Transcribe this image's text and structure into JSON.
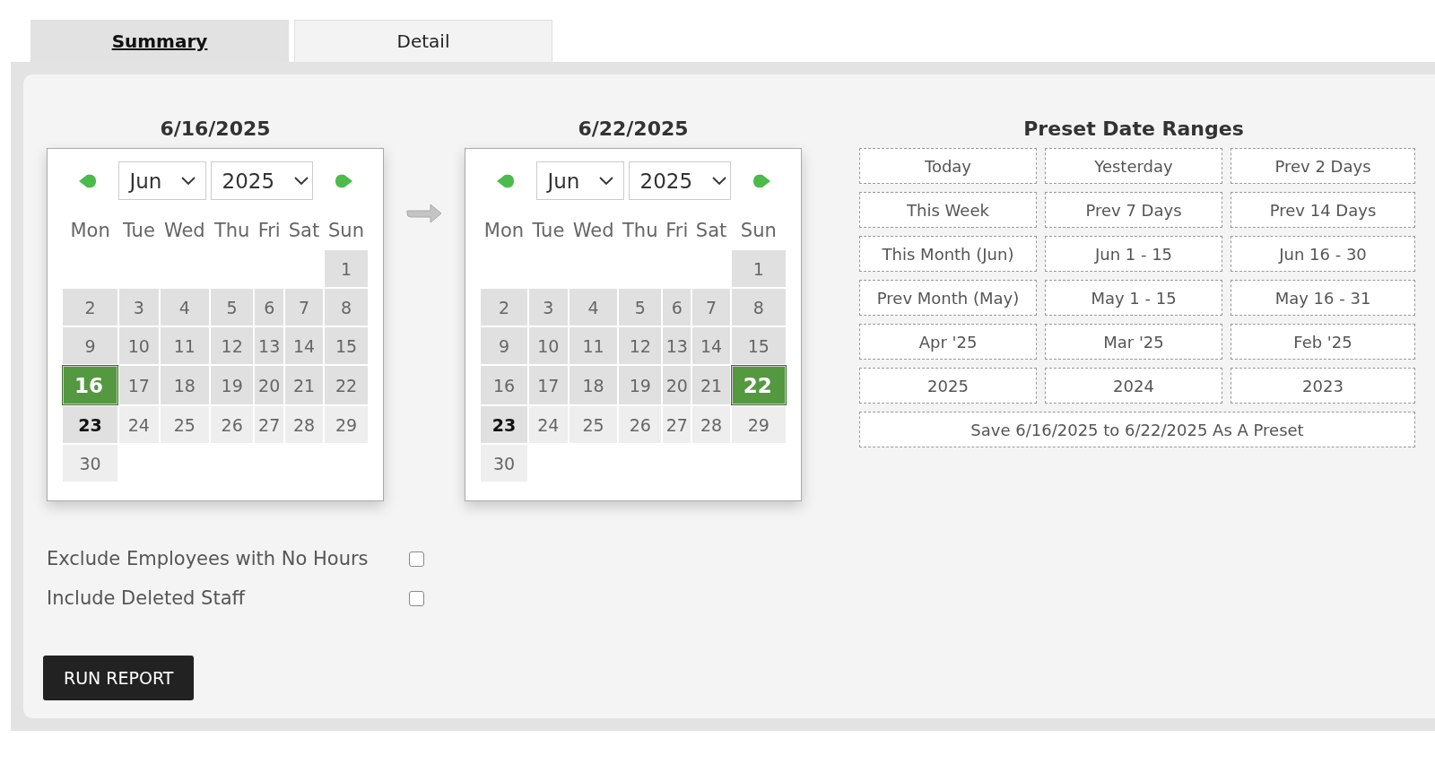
{
  "tabs": [
    {
      "label": "Summary",
      "selected": true
    },
    {
      "label": "Detail",
      "selected": false
    }
  ],
  "calendars": [
    {
      "title": "6/16/2025",
      "month": "Jun",
      "year": "2025",
      "weekdays": [
        "Mon",
        "Tue",
        "Wed",
        "Thu",
        "Fri",
        "Sat",
        "Sun"
      ],
      "weeks": [
        [
          {
            "kind": "blank"
          },
          {
            "kind": "blank"
          },
          {
            "kind": "blank"
          },
          {
            "kind": "blank"
          },
          {
            "kind": "blank"
          },
          {
            "kind": "blank"
          },
          {
            "kind": "day",
            "label": "1",
            "selected": false,
            "today": false,
            "past": true
          }
        ],
        [
          {
            "kind": "day",
            "label": "2",
            "selected": false,
            "today": false,
            "past": true
          },
          {
            "kind": "day",
            "label": "3",
            "selected": false,
            "today": false,
            "past": true
          },
          {
            "kind": "day",
            "label": "4",
            "selected": false,
            "today": false,
            "past": true
          },
          {
            "kind": "day",
            "label": "5",
            "selected": false,
            "today": false,
            "past": true
          },
          {
            "kind": "day",
            "label": "6",
            "selected": false,
            "today": false,
            "past": true
          },
          {
            "kind": "day",
            "label": "7",
            "selected": false,
            "today": false,
            "past": true
          },
          {
            "kind": "day",
            "label": "8",
            "selected": false,
            "today": false,
            "past": true
          }
        ],
        [
          {
            "kind": "day",
            "label": "9",
            "selected": false,
            "today": false,
            "past": true
          },
          {
            "kind": "day",
            "label": "10",
            "selected": false,
            "today": false,
            "past": true
          },
          {
            "kind": "day",
            "label": "11",
            "selected": false,
            "today": false,
            "past": true
          },
          {
            "kind": "day",
            "label": "12",
            "selected": false,
            "today": false,
            "past": true
          },
          {
            "kind": "day",
            "label": "13",
            "selected": false,
            "today": false,
            "past": true
          },
          {
            "kind": "day",
            "label": "14",
            "selected": false,
            "today": false,
            "past": true
          },
          {
            "kind": "day",
            "label": "15",
            "selected": false,
            "today": false,
            "past": true
          }
        ],
        [
          {
            "kind": "day",
            "label": "16",
            "selected": true,
            "today": false,
            "past": true
          },
          {
            "kind": "day",
            "label": "17",
            "selected": false,
            "today": false,
            "past": true
          },
          {
            "kind": "day",
            "label": "18",
            "selected": false,
            "today": false,
            "past": true
          },
          {
            "kind": "day",
            "label": "19",
            "selected": false,
            "today": false,
            "past": true
          },
          {
            "kind": "day",
            "label": "20",
            "selected": false,
            "today": false,
            "past": true
          },
          {
            "kind": "day",
            "label": "21",
            "selected": false,
            "today": false,
            "past": true
          },
          {
            "kind": "day",
            "label": "22",
            "selected": false,
            "today": false,
            "past": true
          }
        ],
        [
          {
            "kind": "day",
            "label": "23",
            "selected": false,
            "today": true,
            "past": false
          },
          {
            "kind": "day",
            "label": "24",
            "selected": false,
            "today": false,
            "past": false
          },
          {
            "kind": "day",
            "label": "25",
            "selected": false,
            "today": false,
            "past": false
          },
          {
            "kind": "day",
            "label": "26",
            "selected": false,
            "today": false,
            "past": false
          },
          {
            "kind": "day",
            "label": "27",
            "selected": false,
            "today": false,
            "past": false
          },
          {
            "kind": "day",
            "label": "28",
            "selected": false,
            "today": false,
            "past": false
          },
          {
            "kind": "day",
            "label": "29",
            "selected": false,
            "today": false,
            "past": false
          }
        ],
        [
          {
            "kind": "day",
            "label": "30",
            "selected": false,
            "today": false,
            "past": false
          }
        ]
      ]
    },
    {
      "title": "6/22/2025",
      "month": "Jun",
      "year": "2025",
      "weekdays": [
        "Mon",
        "Tue",
        "Wed",
        "Thu",
        "Fri",
        "Sat",
        "Sun"
      ],
      "weeks": [
        [
          {
            "kind": "blank"
          },
          {
            "kind": "blank"
          },
          {
            "kind": "blank"
          },
          {
            "kind": "blank"
          },
          {
            "kind": "blank"
          },
          {
            "kind": "blank"
          },
          {
            "kind": "day",
            "label": "1",
            "selected": false,
            "today": false,
            "past": true
          }
        ],
        [
          {
            "kind": "day",
            "label": "2",
            "selected": false,
            "today": false,
            "past": true
          },
          {
            "kind": "day",
            "label": "3",
            "selected": false,
            "today": false,
            "past": true
          },
          {
            "kind": "day",
            "label": "4",
            "selected": false,
            "today": false,
            "past": true
          },
          {
            "kind": "day",
            "label": "5",
            "selected": false,
            "today": false,
            "past": true
          },
          {
            "kind": "day",
            "label": "6",
            "selected": false,
            "today": false,
            "past": true
          },
          {
            "kind": "day",
            "label": "7",
            "selected": false,
            "today": false,
            "past": true
          },
          {
            "kind": "day",
            "label": "8",
            "selected": false,
            "today": false,
            "past": true
          }
        ],
        [
          {
            "kind": "day",
            "label": "9",
            "selected": false,
            "today": false,
            "past": true
          },
          {
            "kind": "day",
            "label": "10",
            "selected": false,
            "today": false,
            "past": true
          },
          {
            "kind": "day",
            "label": "11",
            "selected": false,
            "today": false,
            "past": true
          },
          {
            "kind": "day",
            "label": "12",
            "selected": false,
            "today": false,
            "past": true
          },
          {
            "kind": "day",
            "label": "13",
            "selected": false,
            "today": false,
            "past": true
          },
          {
            "kind": "day",
            "label": "14",
            "selected": false,
            "today": false,
            "past": true
          },
          {
            "kind": "day",
            "label": "15",
            "selected": false,
            "today": false,
            "past": true
          }
        ],
        [
          {
            "kind": "day",
            "label": "16",
            "selected": false,
            "today": false,
            "past": true
          },
          {
            "kind": "day",
            "label": "17",
            "selected": false,
            "today": false,
            "past": true
          },
          {
            "kind": "day",
            "label": "18",
            "selected": false,
            "today": false,
            "past": true
          },
          {
            "kind": "day",
            "label": "19",
            "selected": false,
            "today": false,
            "past": true
          },
          {
            "kind": "day",
            "label": "20",
            "selected": false,
            "today": false,
            "past": true
          },
          {
            "kind": "day",
            "label": "21",
            "selected": false,
            "today": false,
            "past": true
          },
          {
            "kind": "day",
            "label": "22",
            "selected": true,
            "today": false,
            "past": true
          }
        ],
        [
          {
            "kind": "day",
            "label": "23",
            "selected": false,
            "today": true,
            "past": false
          },
          {
            "kind": "day",
            "label": "24",
            "selected": false,
            "today": false,
            "past": false
          },
          {
            "kind": "day",
            "label": "25",
            "selected": false,
            "today": false,
            "past": false
          },
          {
            "kind": "day",
            "label": "26",
            "selected": false,
            "today": false,
            "past": false
          },
          {
            "kind": "day",
            "label": "27",
            "selected": false,
            "today": false,
            "past": false
          },
          {
            "kind": "day",
            "label": "28",
            "selected": false,
            "today": false,
            "past": false
          },
          {
            "kind": "day",
            "label": "29",
            "selected": false,
            "today": false,
            "past": false
          }
        ],
        [
          {
            "kind": "day",
            "label": "30",
            "selected": false,
            "today": false,
            "past": false
          }
        ]
      ]
    }
  ],
  "presets": {
    "title": "Preset Date Ranges",
    "items": [
      "Today",
      "Yesterday",
      "Prev 2 Days",
      "This Week",
      "Prev 7 Days",
      "Prev 14 Days",
      "This Month (Jun)",
      "Jun 1 - 15",
      "Jun 16 - 30",
      "Prev Month (May)",
      "May 1 - 15",
      "May 16 - 31",
      "Apr '25",
      "Mar '25",
      "Feb '25",
      "2025",
      "2024",
      "2023"
    ],
    "save": "Save 6/16/2025 to 6/22/2025 As A Preset"
  },
  "options": [
    {
      "label": "Exclude Employees with No Hours",
      "checked": false
    },
    {
      "label": "Include Deleted Staff",
      "checked": false
    }
  ],
  "run_button": "RUN REPORT"
}
